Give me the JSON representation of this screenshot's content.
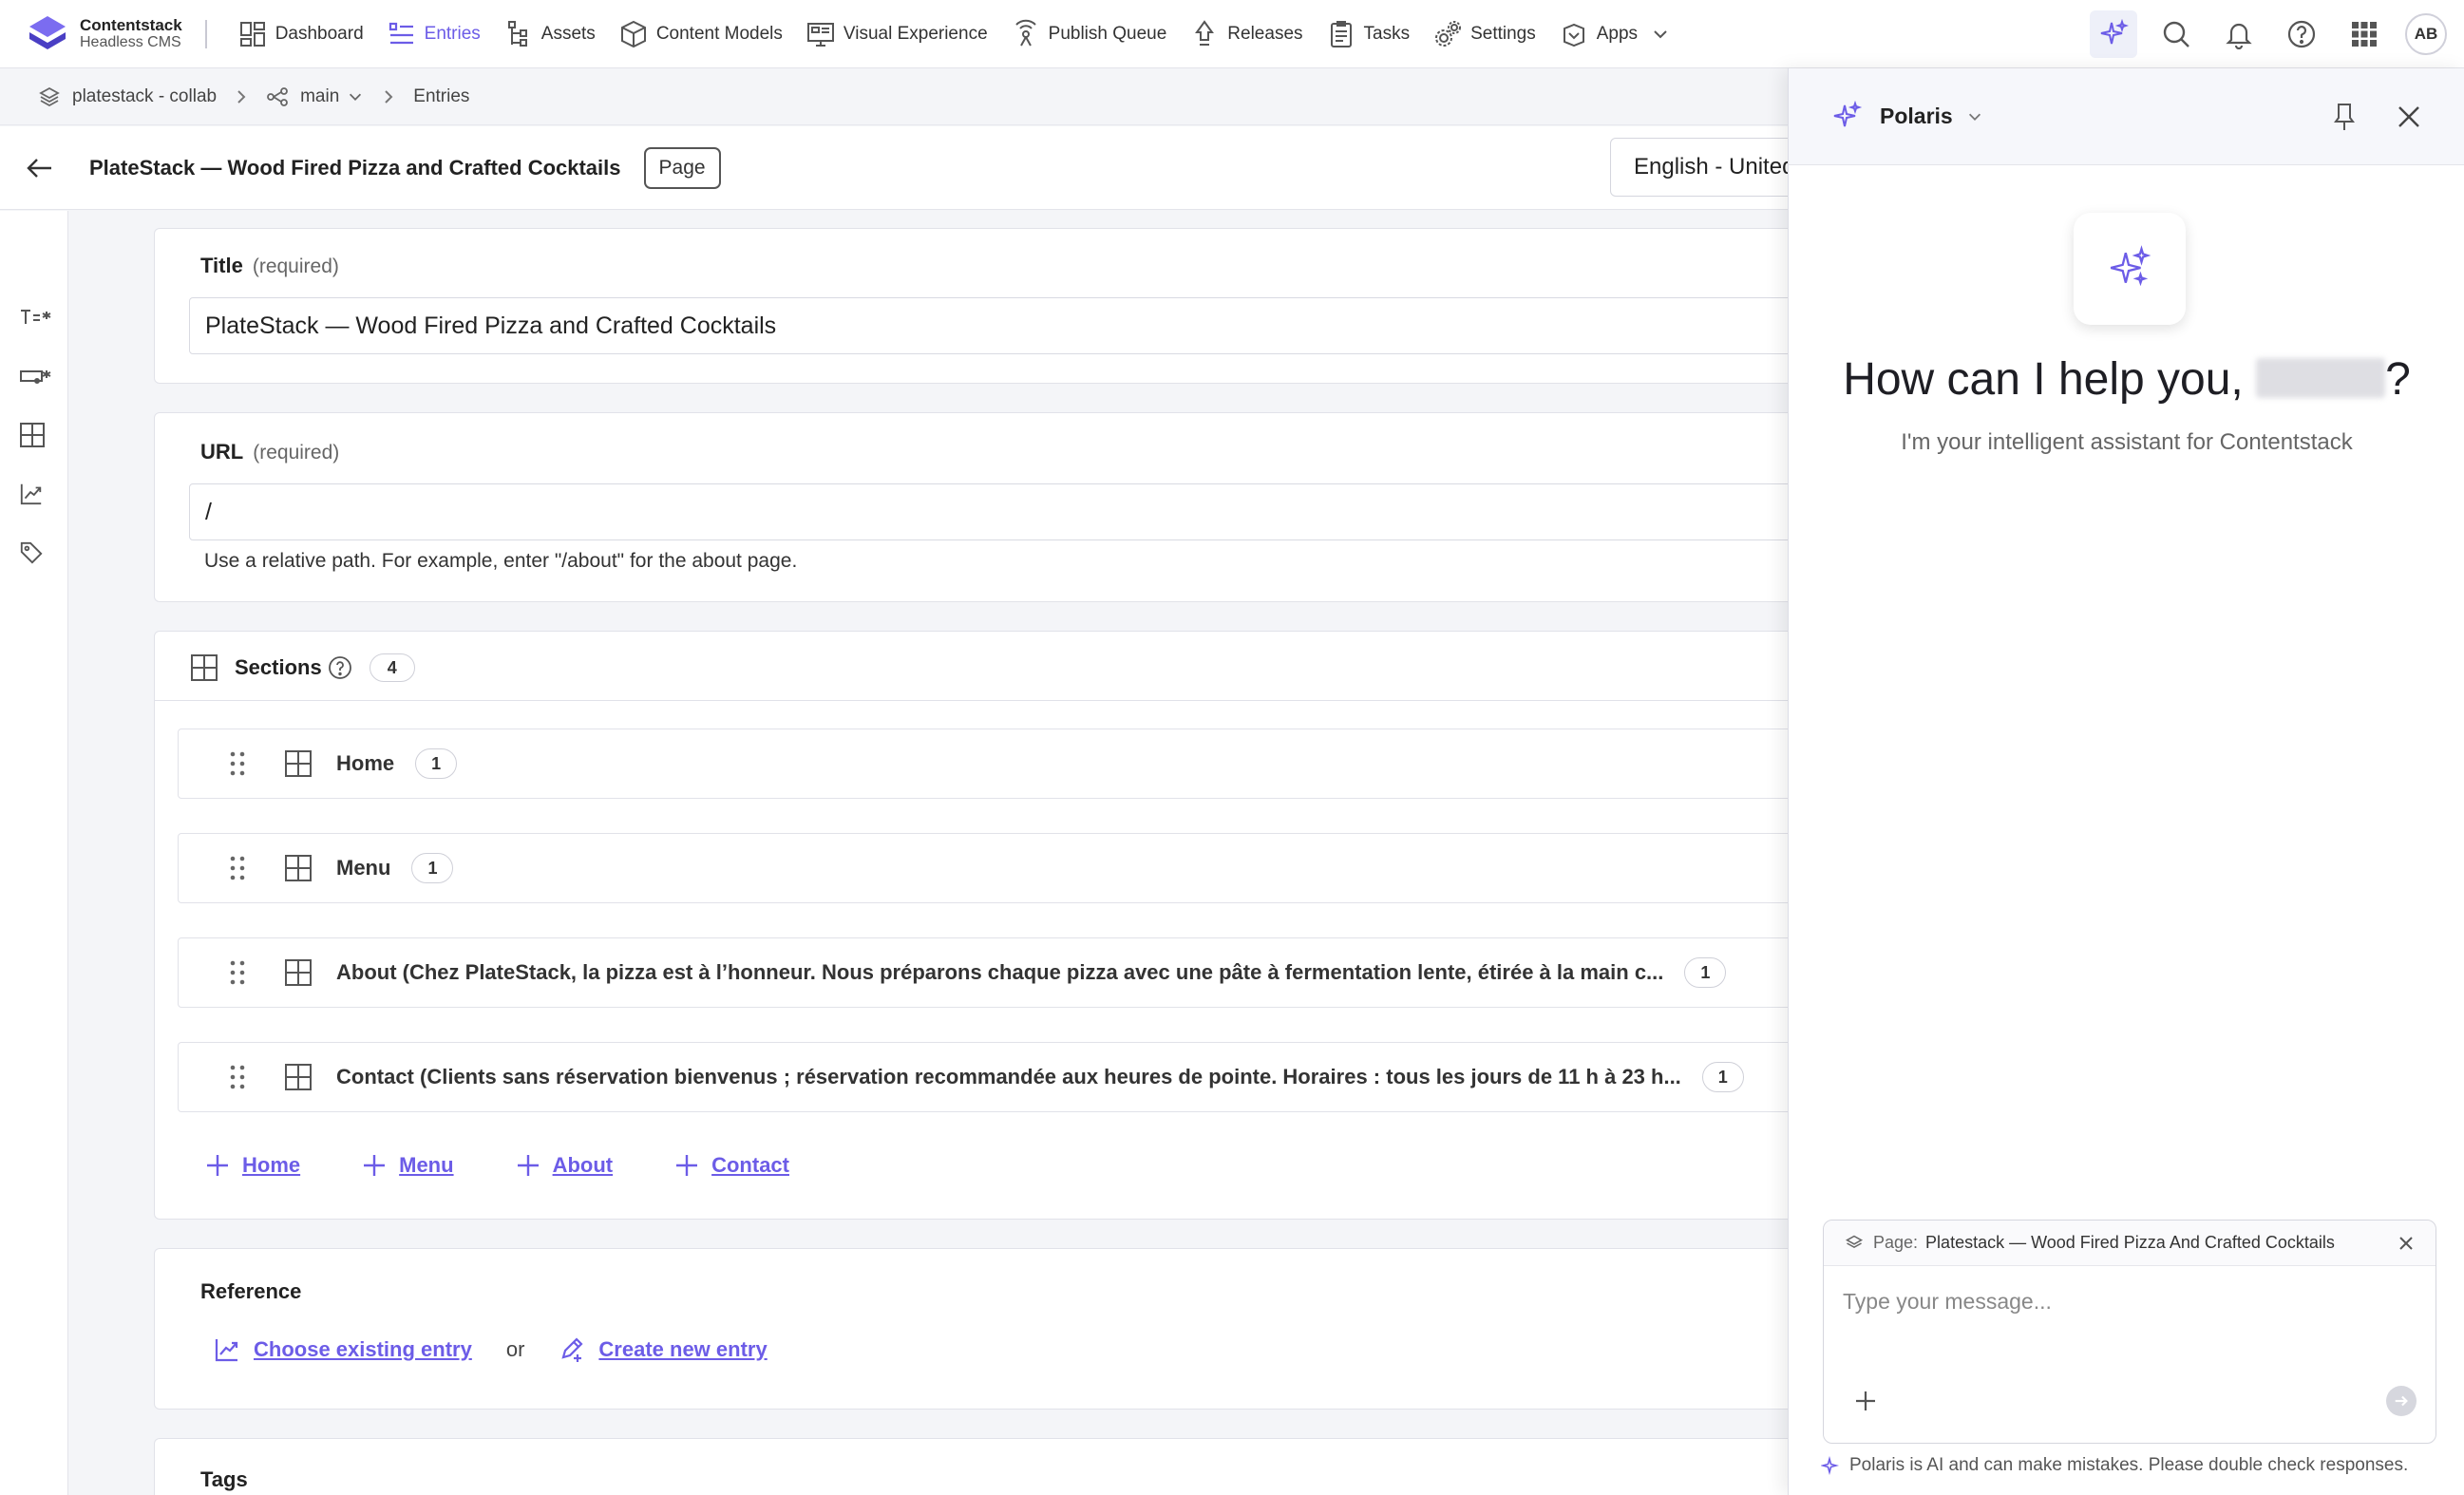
{
  "brand": {
    "name": "Contentstack",
    "subtitle": "Headless CMS"
  },
  "nav": {
    "items": [
      {
        "label": "Dashboard",
        "icon": "dashboard-icon",
        "active": false
      },
      {
        "label": "Entries",
        "icon": "entries-icon",
        "active": true
      },
      {
        "label": "Assets",
        "icon": "assets-icon",
        "active": false
      },
      {
        "label": "Content Models",
        "icon": "content-models-icon",
        "active": false
      },
      {
        "label": "Visual Experience",
        "icon": "visual-experience-icon",
        "active": false
      },
      {
        "label": "Publish Queue",
        "icon": "publish-queue-icon",
        "active": false
      },
      {
        "label": "Releases",
        "icon": "releases-icon",
        "active": false
      },
      {
        "label": "Tasks",
        "icon": "tasks-icon",
        "active": false
      },
      {
        "label": "Settings",
        "icon": "settings-icon",
        "active": false
      },
      {
        "label": "Apps",
        "icon": "apps-icon",
        "active": false
      }
    ],
    "avatar_initials": "AB",
    "accent": "#6c5ce7"
  },
  "breadcrumb": {
    "stack": "platestack - collab",
    "branch": "main",
    "section": "Entries"
  },
  "entry": {
    "title": "PlateStack — Wood Fired Pizza and Crafted Cocktails",
    "content_type": "Page",
    "locale": "English - United States"
  },
  "fields": {
    "title": {
      "label": "Title",
      "required": "(required)",
      "value": "PlateStack — Wood Fired Pizza and Crafted Cocktails"
    },
    "url": {
      "label": "URL",
      "required": "(required)",
      "value": "/",
      "help": "Use a relative path. For example, enter \"/about\" for the about page."
    },
    "sections": {
      "label": "Sections",
      "count": "4",
      "blocks": [
        {
          "label": "Home",
          "count": "1"
        },
        {
          "label": "Menu",
          "count": "1"
        },
        {
          "label": "About (Chez PlateStack, la pizza est à l’honneur. Nous préparons chaque pizza avec une pâte à fermentation lente, étirée à la main c...",
          "count": "1"
        },
        {
          "label": "Contact (Clients sans réservation bienvenus ; réservation recommandée aux heures de pointe. Horaires : tous les jours de 11 h à 23 h...",
          "count": "1"
        }
      ],
      "add_links": [
        "Home",
        "Menu",
        "About",
        "Contact"
      ]
    },
    "reference": {
      "label": "Reference",
      "choose_existing": "Choose existing entry",
      "or": "or",
      "create_new": "Create new entry"
    },
    "tags": {
      "label": "Tags"
    }
  },
  "polaris": {
    "title": "Polaris",
    "greeting_prefix": "How can I help you,",
    "greeting_suffix": "?",
    "subtitle": "I'm your intelligent assistant for Contentstack",
    "context_label": "Page:",
    "context_value": "Platestack — Wood Fired Pizza And Crafted Cocktails",
    "input_placeholder": "Type your message...",
    "disclaimer": "Polaris is AI and can make mistakes. Please double check responses."
  }
}
